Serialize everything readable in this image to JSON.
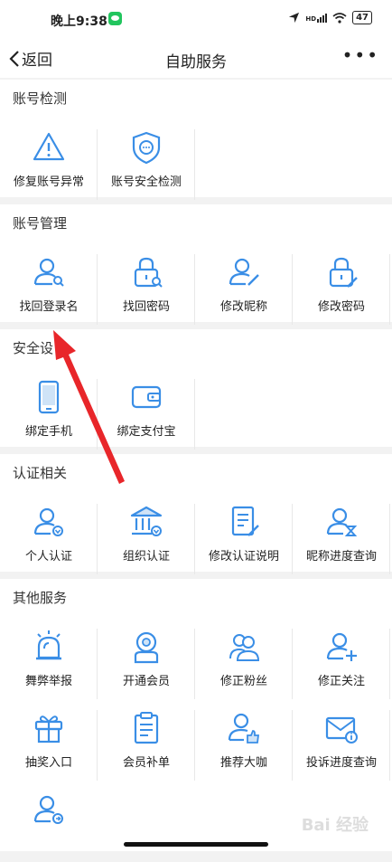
{
  "status": {
    "time": "晚上9:38",
    "battery": "47",
    "signal": "HD"
  },
  "nav": {
    "back": "返回",
    "title": "自助服务",
    "more": "•••"
  },
  "sections": {
    "detect": {
      "title": "账号检测",
      "items": [
        "修复账号异常",
        "账号安全检测"
      ]
    },
    "manage": {
      "title": "账号管理",
      "items": [
        "找回登录名",
        "找回密码",
        "修改昵称",
        "修改密码"
      ]
    },
    "security": {
      "title": "安全设",
      "items": [
        "绑定手机",
        "绑定支付宝"
      ]
    },
    "auth": {
      "title": "认证相关",
      "items": [
        "个人认证",
        "组织认证",
        "修改认证说明",
        "昵称进度查询"
      ]
    },
    "other": {
      "title": "其他服务",
      "items": [
        "舞弊举报",
        "开通会员",
        "修正粉丝",
        "修正关注",
        "抽奖入口",
        "会员补单",
        "推荐大咖",
        "投诉进度查询"
      ]
    }
  },
  "watermark": "Bai 经验",
  "colors": {
    "icon_blue": "#3a8ee6",
    "arrow_red": "#e8262a",
    "divider": "#f2f2f2"
  }
}
